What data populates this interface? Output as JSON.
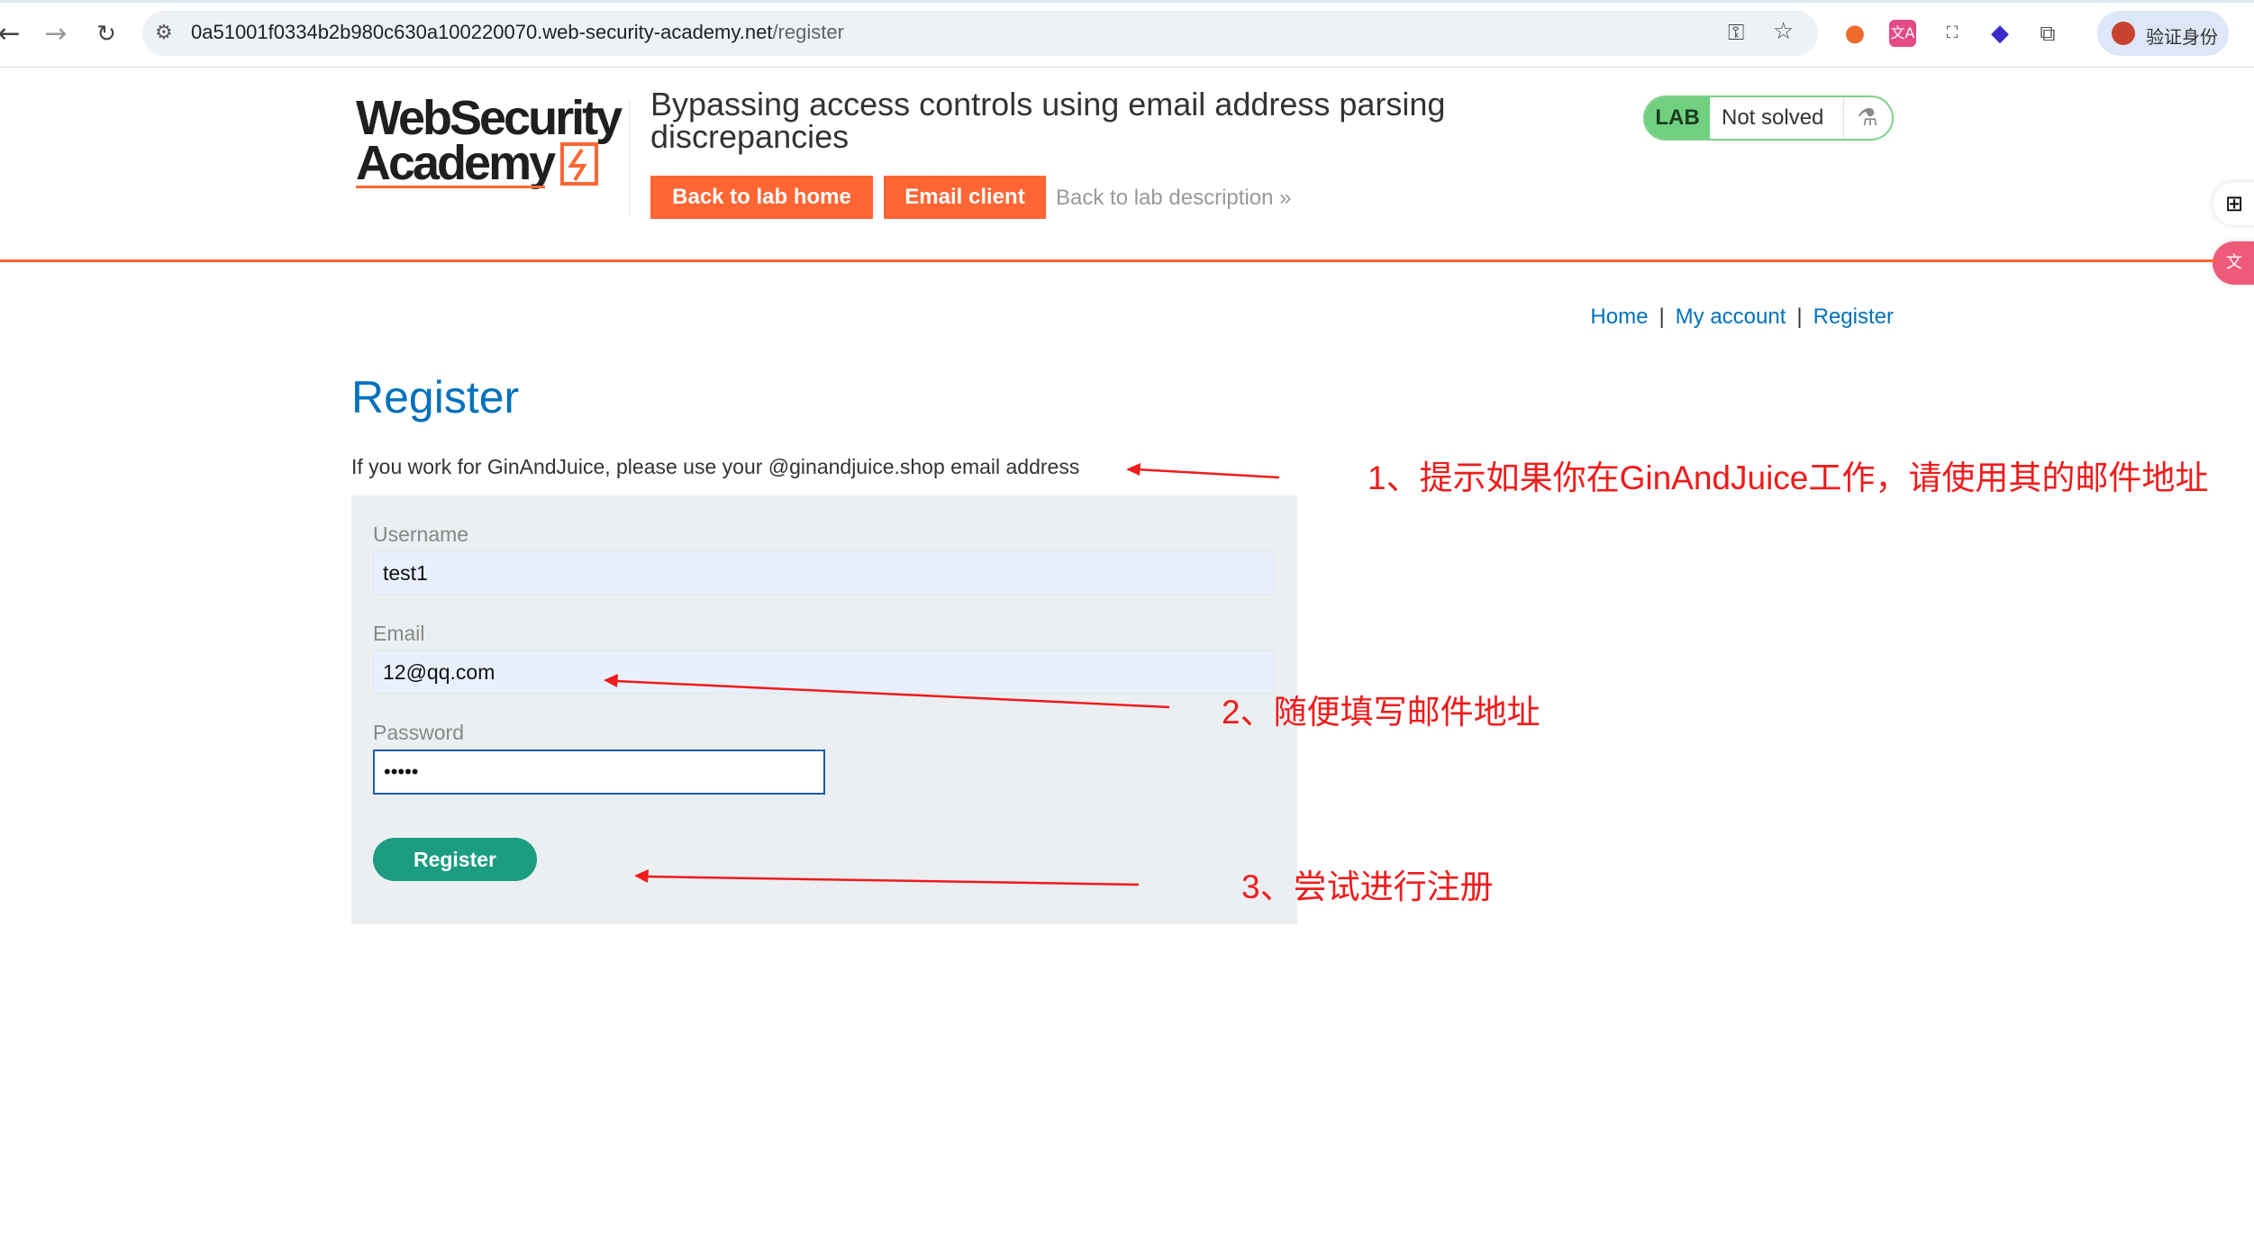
{
  "browser": {
    "url_host": "0a51001f0334b2b980c630a100220070.web-security-academy.net",
    "url_path": "/register",
    "back_icon": "arrow-left-icon",
    "forward_icon": "arrow-right-icon",
    "reload_icon": "reload-icon",
    "profile_label": "验证身份"
  },
  "header": {
    "logo_line1": "WebSecurity",
    "logo_line2": "Academy",
    "lab_title": "Bypassing access controls using email address parsing discrepancies",
    "back_to_lab_home": "Back to lab home",
    "email_client": "Email client",
    "back_to_description": "Back to lab description",
    "chevron": "»",
    "lab_badge": "LAB",
    "lab_status": "Not solved",
    "accent": "#ff6633"
  },
  "nav": {
    "home": "Home",
    "sep": "|",
    "my_account": "My account",
    "register": "Register"
  },
  "page": {
    "title": "Register",
    "hint": "If you work for GinAndJuice, please use your @ginandjuice.shop email address"
  },
  "form": {
    "username_label": "Username",
    "username_value": "test1",
    "email_label": "Email",
    "email_value": "12@qq.com",
    "password_label": "Password",
    "password_value": "•••••",
    "submit_label": "Register"
  },
  "annotations": {
    "note1": "1、提示如果你在GinAndJuice工作，请使用其的邮件地址",
    "note2": "2、随便填写邮件地址",
    "note3": "3、尝试进行注册",
    "color": "#f01b1b"
  }
}
